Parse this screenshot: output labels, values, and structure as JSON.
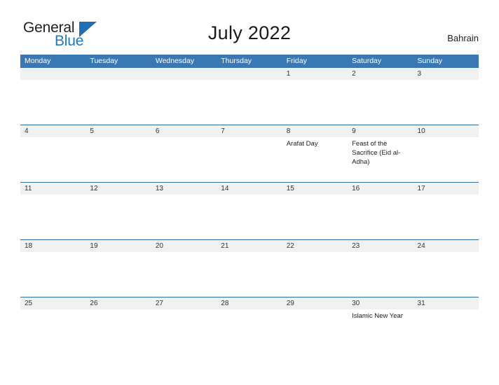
{
  "brand": {
    "name_part1": "General",
    "name_part2": "Blue",
    "triangle_icon": "triangle-logo-icon",
    "accent_color": "#1f78c1"
  },
  "header": {
    "title": "July 2022",
    "country": "Bahrain",
    "header_bg_color": "#3a78b5",
    "row_divider_color": "#2f6da8",
    "date_band_color": "#f1f1f1"
  },
  "calendar": {
    "weekdays": [
      "Monday",
      "Tuesday",
      "Wednesday",
      "Thursday",
      "Friday",
      "Saturday",
      "Sunday"
    ],
    "weeks": [
      {
        "days": [
          {
            "num": "",
            "event": ""
          },
          {
            "num": "",
            "event": ""
          },
          {
            "num": "",
            "event": ""
          },
          {
            "num": "",
            "event": ""
          },
          {
            "num": "1",
            "event": ""
          },
          {
            "num": "2",
            "event": ""
          },
          {
            "num": "3",
            "event": ""
          }
        ]
      },
      {
        "days": [
          {
            "num": "4",
            "event": ""
          },
          {
            "num": "5",
            "event": ""
          },
          {
            "num": "6",
            "event": ""
          },
          {
            "num": "7",
            "event": ""
          },
          {
            "num": "8",
            "event": "Arafat Day"
          },
          {
            "num": "9",
            "event": "Feast of the Sacrifice (Eid al-Adha)"
          },
          {
            "num": "10",
            "event": ""
          }
        ]
      },
      {
        "days": [
          {
            "num": "11",
            "event": ""
          },
          {
            "num": "12",
            "event": ""
          },
          {
            "num": "13",
            "event": ""
          },
          {
            "num": "14",
            "event": ""
          },
          {
            "num": "15",
            "event": ""
          },
          {
            "num": "16",
            "event": ""
          },
          {
            "num": "17",
            "event": ""
          }
        ]
      },
      {
        "days": [
          {
            "num": "18",
            "event": ""
          },
          {
            "num": "19",
            "event": ""
          },
          {
            "num": "20",
            "event": ""
          },
          {
            "num": "21",
            "event": ""
          },
          {
            "num": "22",
            "event": ""
          },
          {
            "num": "23",
            "event": ""
          },
          {
            "num": "24",
            "event": ""
          }
        ]
      },
      {
        "days": [
          {
            "num": "25",
            "event": ""
          },
          {
            "num": "26",
            "event": ""
          },
          {
            "num": "27",
            "event": ""
          },
          {
            "num": "28",
            "event": ""
          },
          {
            "num": "29",
            "event": ""
          },
          {
            "num": "30",
            "event": "Islamic New Year"
          },
          {
            "num": "31",
            "event": ""
          }
        ]
      }
    ]
  }
}
